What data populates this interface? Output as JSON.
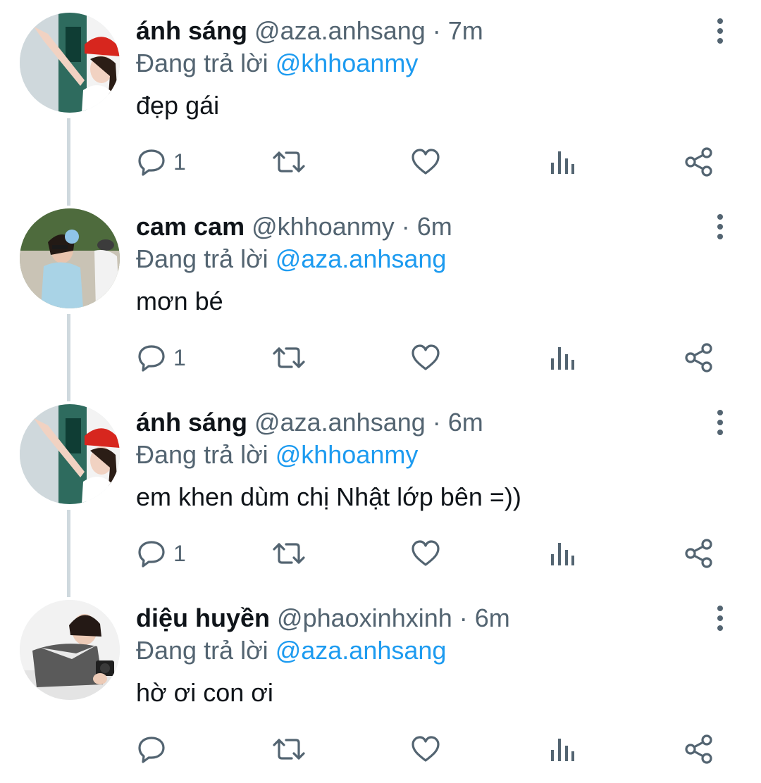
{
  "colors": {
    "text": "#0f1419",
    "secondary": "#536471",
    "link": "#1d9bf0",
    "thread_line": "#cfd9de"
  },
  "tweets": [
    {
      "name": "ánh sáng",
      "handle": "@aza.anhsang",
      "time": "· 7m",
      "reply_prefix": "Đang trả lời",
      "reply_to": "@khhoanmy",
      "text": "đẹp gái",
      "reply_count": "1",
      "avatar": "girl-red-cap-photo"
    },
    {
      "name": "cam cam",
      "handle": "@khhoanmy",
      "time": "· 6m",
      "reply_prefix": "Đang trả lời",
      "reply_to": "@aza.anhsang",
      "text": "mơn bé",
      "reply_count": "1",
      "avatar": "girl-blue-scrunchie-photo"
    },
    {
      "name": "ánh sáng",
      "handle": "@aza.anhsang",
      "time": "· 6m",
      "reply_prefix": "Đang trả lời",
      "reply_to": "@khhoanmy",
      "text": "em khen dùm chị Nhật lớp bên =))",
      "reply_count": "1",
      "avatar": "girl-red-cap-photo"
    },
    {
      "name": "diệu huyền",
      "handle": "@phaoxinhxinh",
      "time": "· 6m",
      "reply_prefix": "Đang trả lời",
      "reply_to": "@aza.anhsang",
      "text": "hờ ơi con ơi",
      "reply_count": "",
      "avatar": "girl-camera-photo"
    }
  ],
  "icons": {
    "reply": "reply-icon",
    "retweet": "retweet-icon",
    "like": "heart-icon",
    "views": "views-icon",
    "share": "share-icon",
    "more": "more-vertical-icon"
  }
}
